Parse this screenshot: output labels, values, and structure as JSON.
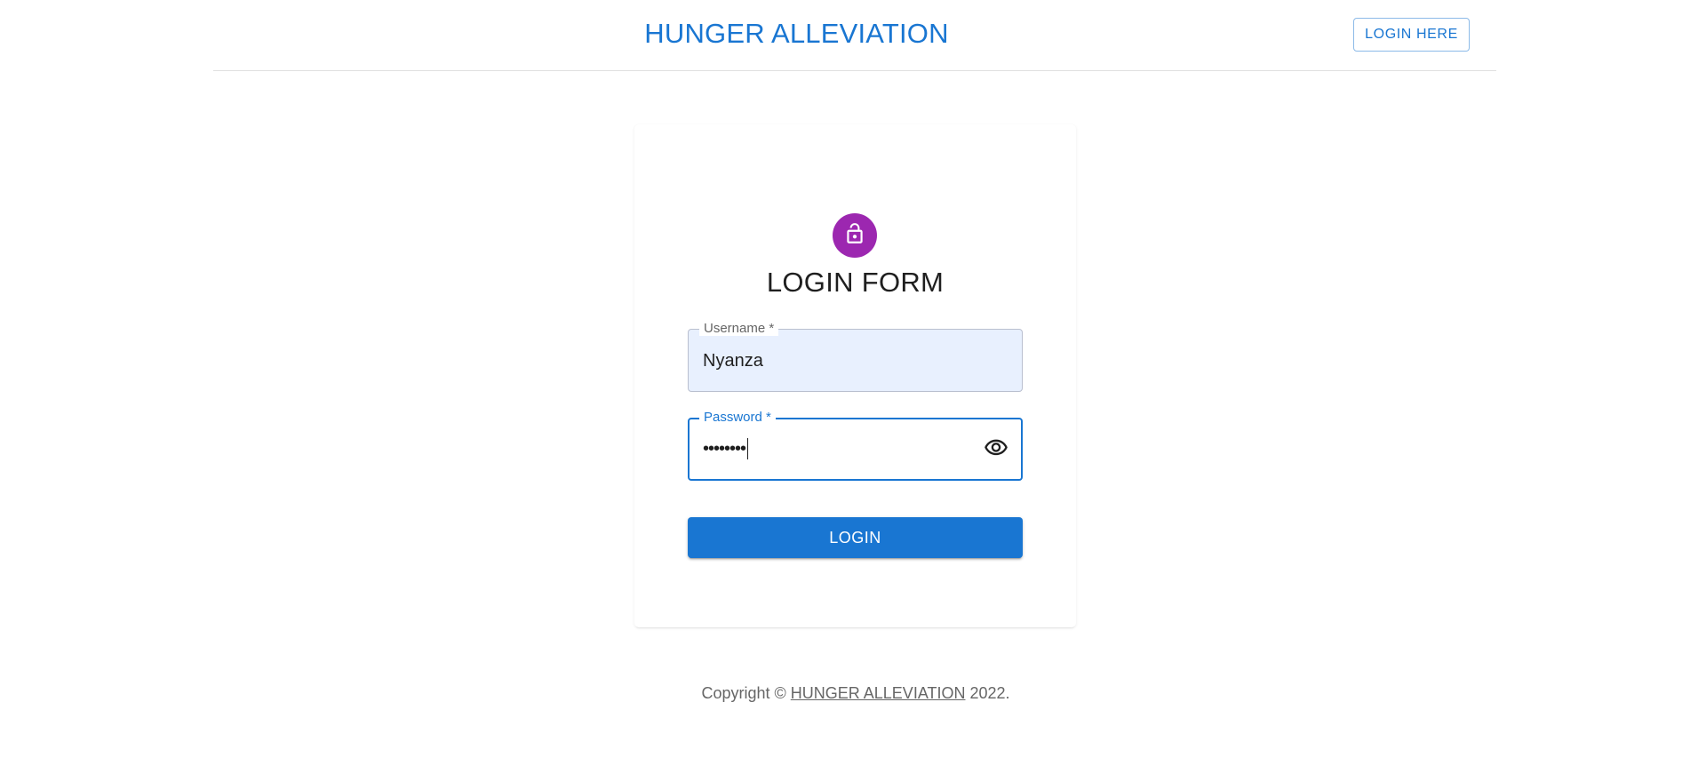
{
  "header": {
    "site_title": "HUNGER ALLEVIATION",
    "login_here_label": "LOGIN HERE"
  },
  "login_card": {
    "avatar_icon": "lock-open-icon",
    "title": "LOGIN FORM",
    "username": {
      "label": "Username *",
      "value": "Nyanza"
    },
    "password": {
      "label": "Password *",
      "masked_value": "••••••••",
      "toggle_icon": "visibility-eye-icon"
    },
    "submit_label": "LOGIN"
  },
  "footer": {
    "prefix": "Copyright © ",
    "link_text": "HUNGER ALLEVIATION",
    "suffix": " 2022."
  },
  "colors": {
    "primary": "#1976d2",
    "avatar": "#9c27b0",
    "autofill_bg": "#e8f0fe"
  }
}
